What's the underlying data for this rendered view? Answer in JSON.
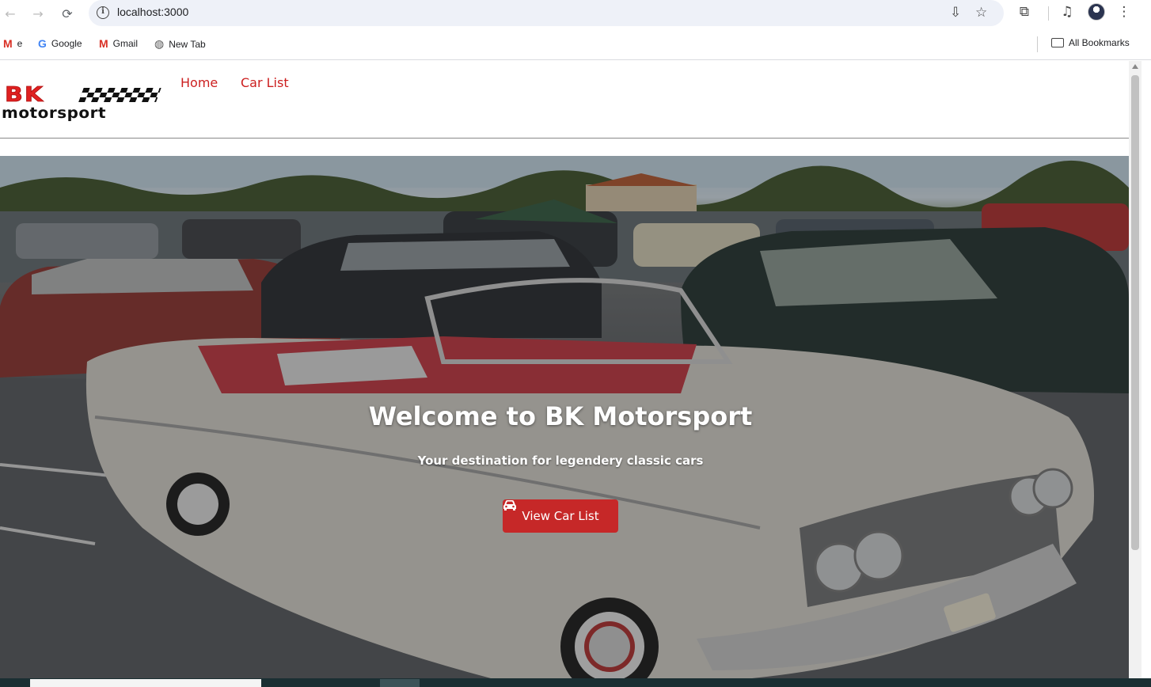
{
  "browser": {
    "url": "localhost:3000",
    "bookmarks": [
      {
        "icon": "gmail-icon",
        "label": "e"
      },
      {
        "icon": "google-icon",
        "label": "Google"
      },
      {
        "icon": "gmail-icon",
        "label": "Gmail"
      },
      {
        "icon": "globe-icon",
        "label": "New Tab"
      }
    ],
    "all_bookmarks": "All Bookmarks"
  },
  "site": {
    "logo_bk": "BK",
    "logo_motorsport": "motorsport",
    "nav": [
      {
        "label": "Home"
      },
      {
        "label": "Car List"
      }
    ]
  },
  "hero": {
    "title": "Welcome to BK Motorsport",
    "subtitle": "Your destination for legendery classic cars",
    "button_label": "View Car List",
    "button_icon": "car-icon",
    "button_color": "#c62828"
  },
  "colors": {
    "accent": "#cc1f1f"
  }
}
